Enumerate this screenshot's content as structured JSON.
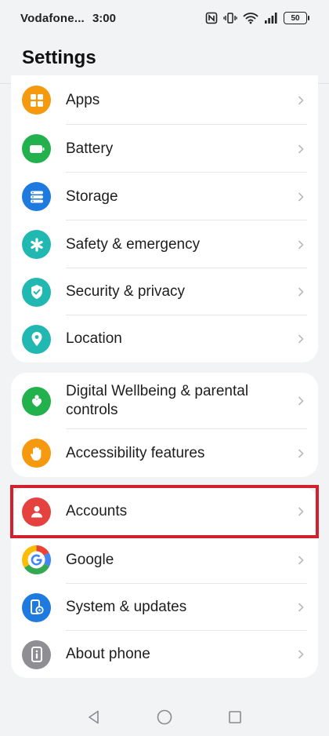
{
  "status_bar": {
    "carrier": "Vodafone...",
    "time": "3:00",
    "battery": "50",
    "icons": [
      "nfc-icon",
      "vibrate-icon",
      "wifi-icon",
      "signal-icon",
      "battery-icon"
    ]
  },
  "header": {
    "title": "Settings"
  },
  "groups": [
    {
      "items": [
        {
          "label": "Apps",
          "icon": "apps-icon",
          "color": "#f59a0e"
        },
        {
          "label": "Battery",
          "icon": "battery-icon",
          "color": "#22b14c"
        },
        {
          "label": "Storage",
          "icon": "storage-icon",
          "color": "#1f7ae0"
        },
        {
          "label": "Safety & emergency",
          "icon": "asterisk-icon",
          "color": "#20b8b0"
        },
        {
          "label": "Security & privacy",
          "icon": "shield-check-icon",
          "color": "#20b8b0"
        },
        {
          "label": "Location",
          "icon": "location-pin-icon",
          "color": "#20b8b0"
        }
      ]
    },
    {
      "items": [
        {
          "label": "Digital Wellbeing & parental controls",
          "icon": "wellbeing-heart-icon",
          "color": "#22b14c"
        },
        {
          "label": "Accessibility features",
          "icon": "hand-icon",
          "color": "#f59a0e"
        }
      ]
    },
    {
      "items": [
        {
          "label": "Accounts",
          "icon": "person-icon",
          "color": "#e5423f",
          "highlighted": true
        },
        {
          "label": "Google",
          "icon": "google-icon",
          "color": "#ffffff"
        },
        {
          "label": "System & updates",
          "icon": "phone-gear-icon",
          "color": "#1f7ae0"
        },
        {
          "label": "About phone",
          "icon": "info-phone-icon",
          "color": "#8e8e93"
        }
      ]
    }
  ],
  "nav_bar": {
    "buttons": [
      "back-icon",
      "home-icon",
      "recents-icon"
    ]
  }
}
